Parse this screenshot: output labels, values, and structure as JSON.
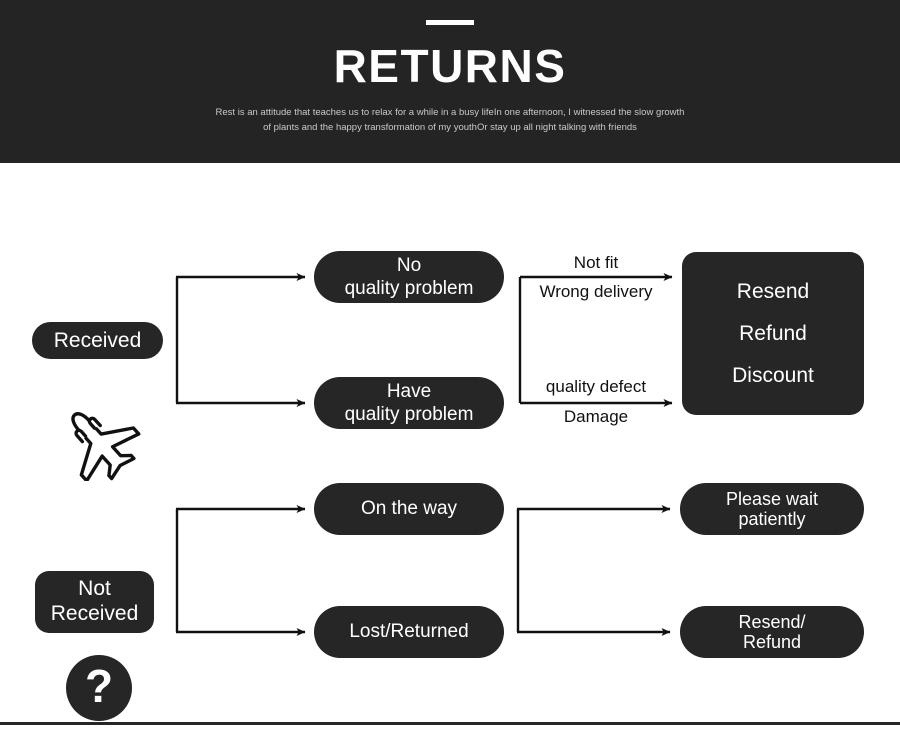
{
  "header": {
    "title": "RETURNS",
    "subtitle": "Rest is an attitude that teaches us to relax for a while in a busy lifeIn one afternoon, I witnessed the slow growth of plants and the happy transformation of my youthOr stay up all night talking with friends",
    "background_color": "#242424",
    "accent_bar_color": "#ffffff"
  },
  "diagram": {
    "node_color": "#262626",
    "node_text_color": "#ffffff",
    "connector_color": "#111111",
    "rows": [
      {
        "id": "received-row",
        "status": {
          "icon": "airplane-icon",
          "label": "Received",
          "label_lines": [
            "Received"
          ]
        },
        "branches": [
          {
            "id": "no-quality-problem",
            "condition_lines": [
              "No",
              "quality problem"
            ],
            "edge_label_above": "Not fit",
            "edge_label_below": "Wrong delivery"
          },
          {
            "id": "have-quality-problem",
            "condition_lines": [
              "Have",
              "quality problem"
            ],
            "edge_label_above": "quality defect",
            "edge_label_below": "Damage"
          }
        ],
        "outcome": {
          "id": "resend-refund-discount",
          "lines": [
            "Resend",
            "Refund",
            "Discount"
          ]
        }
      },
      {
        "id": "not-received-row",
        "status": {
          "icon": "question-mark-icon",
          "icon_glyph": "?",
          "label": "Not Received",
          "label_lines": [
            "Not",
            "Received"
          ]
        },
        "branches": [
          {
            "id": "on-the-way",
            "condition_lines": [
              "On the way"
            ],
            "outcome_lines": [
              "Please wait",
              "patiently"
            ]
          },
          {
            "id": "lost-returned",
            "condition_lines": [
              "Lost/Returned"
            ],
            "outcome_lines": [
              "Resend/",
              "Refund"
            ]
          }
        ]
      }
    ]
  }
}
